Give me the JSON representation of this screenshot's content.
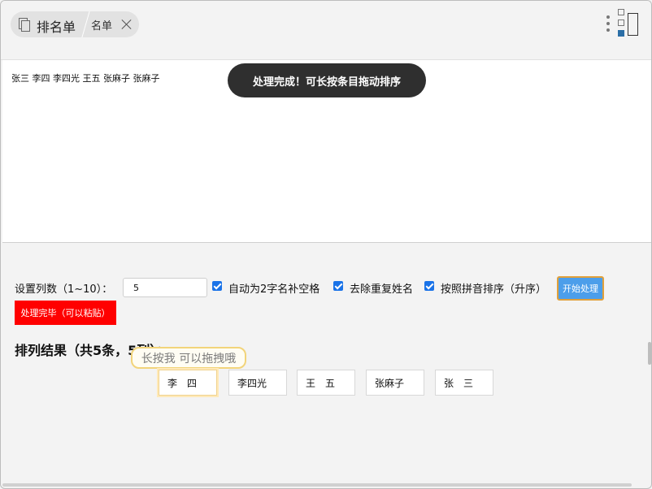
{
  "tab": {
    "title": "排名单",
    "sub_tab": "名单"
  },
  "input_text": "张三 李四 李四光 王五 张麻子 张麻子",
  "toast": "处理完成！可长按条目拖动排序",
  "controls": {
    "columns_label": "设置列数（1~10）：",
    "columns_value": "5",
    "auto_space_label": "自动为2字名补空格",
    "dedupe_label": "去除重复姓名",
    "pinyin_sort_label": "按照拼音排序（升序）",
    "start_button": "开始处理"
  },
  "status": "处理完毕（可以粘贴）",
  "result_heading": "排列结果（共5条，5列）：",
  "tooltip": "长按我 可以拖拽哦",
  "results": [
    "李　四",
    "李四光",
    "王　五",
    "张麻子",
    "张　三"
  ],
  "icons": [
    "document-icon",
    "close-icon",
    "more-vert-icon",
    "layout-toggle-icon",
    "checkbox-checked-icon"
  ],
  "colors": {
    "accent": "#1a73e8",
    "status_bg": "#ff0000",
    "button_bg": "#4c9eea",
    "toast_bg": "#2f2f2f"
  }
}
